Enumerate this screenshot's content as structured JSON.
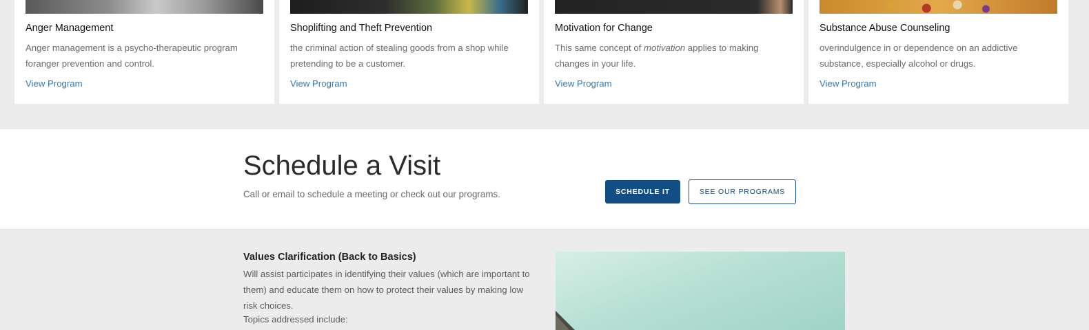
{
  "programs": [
    {
      "title": "Anger Management",
      "description_parts": [
        "Anger management is a psycho-therapeutic program foranger prevention and control.",
        "",
        ""
      ],
      "link": "View Program"
    },
    {
      "title": "Shoplifting and Theft Prevention",
      "description_parts": [
        "the criminal action of stealing goods from a shop while pretending to be a customer.",
        "",
        ""
      ],
      "link": "View Program"
    },
    {
      "title": "Motivation for Change",
      "description_parts": [
        "This same concept of ",
        "motivation",
        " applies to making changes in your life."
      ],
      "link": "View Program"
    },
    {
      "title": "Substance Abuse Counseling",
      "description_parts": [
        "overindulgence in or dependence on an addictive substance, especially alcohol or drugs.",
        "",
        ""
      ],
      "link": "View Program"
    }
  ],
  "schedule": {
    "title": "Schedule a Visit",
    "subtitle": "Call or email to schedule a meeting or check out our programs.",
    "primary_button": "SCHEDULE IT",
    "secondary_button": "SEE OUR PROGRAMS"
  },
  "values": {
    "title": "Values Clarification (Back to Basics)",
    "description": "Will assist participates in identifying their values (which are important to them) and educate them on how to protect their values by making low risk choices.",
    "topics_label": "Topics addressed include:"
  },
  "colors": {
    "accent": "#124d85",
    "link": "#2a7bbd",
    "page_bg": "#ececec"
  }
}
